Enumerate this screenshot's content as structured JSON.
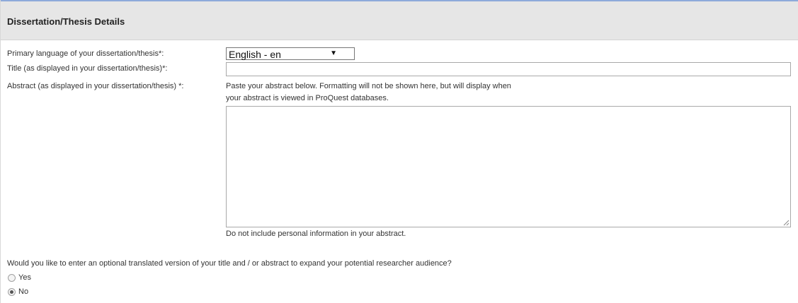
{
  "section": {
    "title": "Dissertation/Thesis Details"
  },
  "fields": {
    "language_label": "Primary language of your dissertation/thesis*:",
    "language_value": "English - en",
    "title_label": "Title (as displayed in your dissertation/thesis)*:",
    "title_value": "",
    "abstract_label": "Abstract (as displayed in your dissertation/thesis) *:",
    "abstract_help_line1": "Paste your abstract below. Formatting will not be shown here, but will display when",
    "abstract_help_line2": "your abstract is viewed in ProQuest databases.",
    "abstract_note": "Do not include personal information in your abstract."
  },
  "translation": {
    "question": "Would you like to enter an optional translated version of your title and / or abstract to expand your potential researcher audience?",
    "options": [
      {
        "label": "Yes",
        "checked": false
      },
      {
        "label": "No",
        "checked": true
      }
    ]
  },
  "colors": {
    "header_bg": "#e6e6e6",
    "header_accent": "#8eaadb"
  }
}
